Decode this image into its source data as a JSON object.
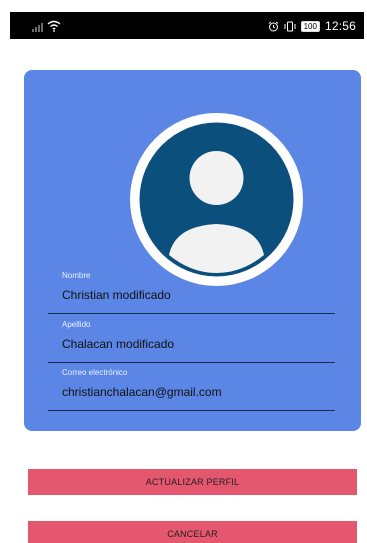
{
  "status_bar": {
    "battery": "100",
    "time": "12:56"
  },
  "profile": {
    "fields": [
      {
        "label": "Nombre",
        "value": "Christian modificado"
      },
      {
        "label": "Apellido",
        "value": "Chalacan modificado"
      },
      {
        "label": "Correo electrónico",
        "value": "christianchalacan@gmail.com"
      }
    ]
  },
  "actions": {
    "update_label": "ACTUALIZAR PERFIL",
    "cancel_label": "CANCELAR"
  },
  "colors": {
    "card": "#5b86e5",
    "avatar": "#0b4f7c",
    "button": "#e5566f"
  }
}
